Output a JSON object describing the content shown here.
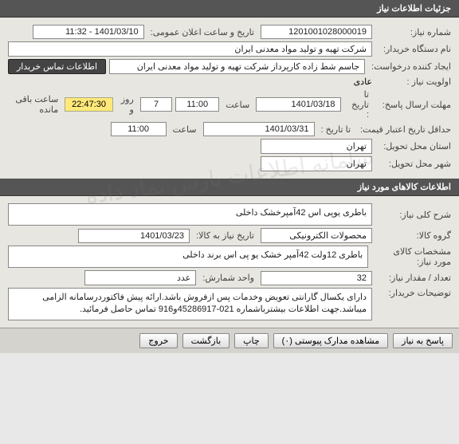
{
  "watermark": "سامانه اطلاعات پارس نماد داده",
  "header1": "جزئیات اطلاعات نیاز",
  "need": {
    "number_label": "شماره نیاز:",
    "number": "1201001028000019",
    "announce_label": "تاریخ و ساعت اعلان عمومی:",
    "announce": "1401/03/10 - 11:32",
    "buyer_label": "نام دستگاه خریدار:",
    "buyer": "شرکت تهیه و تولید مواد معدنی ایران",
    "creator_label": "ایجاد کننده درخواست:",
    "creator": "جاسم شط زاده کارپرداز شرکت تهیه و تولید مواد معدنی ایران",
    "contact_btn": "اطلاعات تماس خریدار",
    "priority_label": "اولویت نیاز :",
    "priority": "عادی",
    "deadline_label": "مهلت ارسال پاسخ:",
    "to_date_label": "تا تاریخ :",
    "deadline_date": "1401/03/18",
    "time_label": "ساعت",
    "deadline_time": "11:00",
    "days": "7",
    "days_label": "روز و",
    "countdown": "22:47:30",
    "remaining_label": "ساعت باقی مانده",
    "validity_label": "حداقل تاریخ اعتبار قیمت:",
    "validity_date": "1401/03/31",
    "validity_time": "11:00",
    "province_label": "استان محل تحویل:",
    "province": "تهران",
    "city_label": "شهر محل تحویل:",
    "city": "تهران"
  },
  "header2": "اطلاعات کالاهای مورد نیاز",
  "goods": {
    "desc_label": "شرح کلی نیاز:",
    "desc": "باطری یوپی اس 42آمپرخشک داخلی",
    "group_label": "گروه کالا:",
    "group": "محصولات الکترونیکی",
    "need_date_label": "تاریخ نیاز به کالا:",
    "need_date": "1401/03/23",
    "spec_label": "مشخصات کالای مورد نیاز:",
    "spec": "باطری 12ولت 42آمپر خشک یو پی اس برند داخلی",
    "qty_label": "تعداد / مقدار نیاز:",
    "qty": "32",
    "unit_label": "واحد شمارش:",
    "unit": "عدد",
    "notes_label": "توضیحات خریدار:",
    "notes": "دارای یکسال گارانتی تعویض وخدمات پس ازفروش باشد.ارائه پیش فاکتوردرسامانه الزامی میباشد.جهت اطلاعات بیشترباشماره 021-45286917و916 تماس حاصل فرمائید."
  },
  "footer": {
    "reply": "پاسخ به نیاز",
    "attach": "مشاهده مدارک پیوستی (۰)",
    "print": "چاپ",
    "back": "بازگشت",
    "exit": "خروج"
  }
}
